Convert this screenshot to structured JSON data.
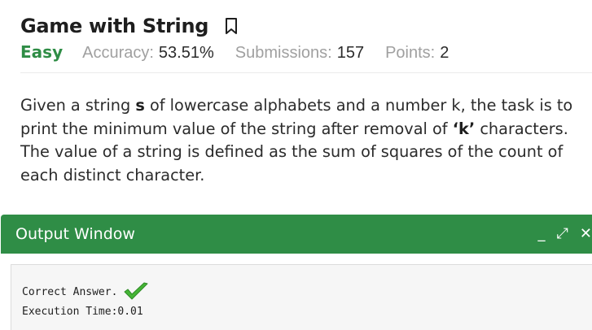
{
  "problem": {
    "title": "Game with String",
    "difficulty": "Easy",
    "accuracy_label": "Accuracy:",
    "accuracy_value": "53.51%",
    "submissions_label": "Submissions:",
    "submissions_value": "157",
    "points_label": "Points:",
    "points_value": "2",
    "statement": {
      "p1": "Given a string ",
      "p2": "s",
      "p3": " of lowercase alphabets and a number k, the task is to print the minimum value of the string after removal of ",
      "p4": "‘k’",
      "p5": " characters. The value of a string is defined as the sum of squares of the count of each distinct character."
    }
  },
  "output_window": {
    "title": "Output Window",
    "controls": {
      "minimize": "_",
      "expand": "⤢",
      "close": "✕"
    },
    "result_text": "Correct Answer.",
    "execution_time": "Execution Time:0.01"
  },
  "icons": {
    "bookmark": "bookmark-icon",
    "check": "checkmark-icon"
  },
  "colors": {
    "accent": "#2f8d46",
    "check": "#45b536"
  }
}
